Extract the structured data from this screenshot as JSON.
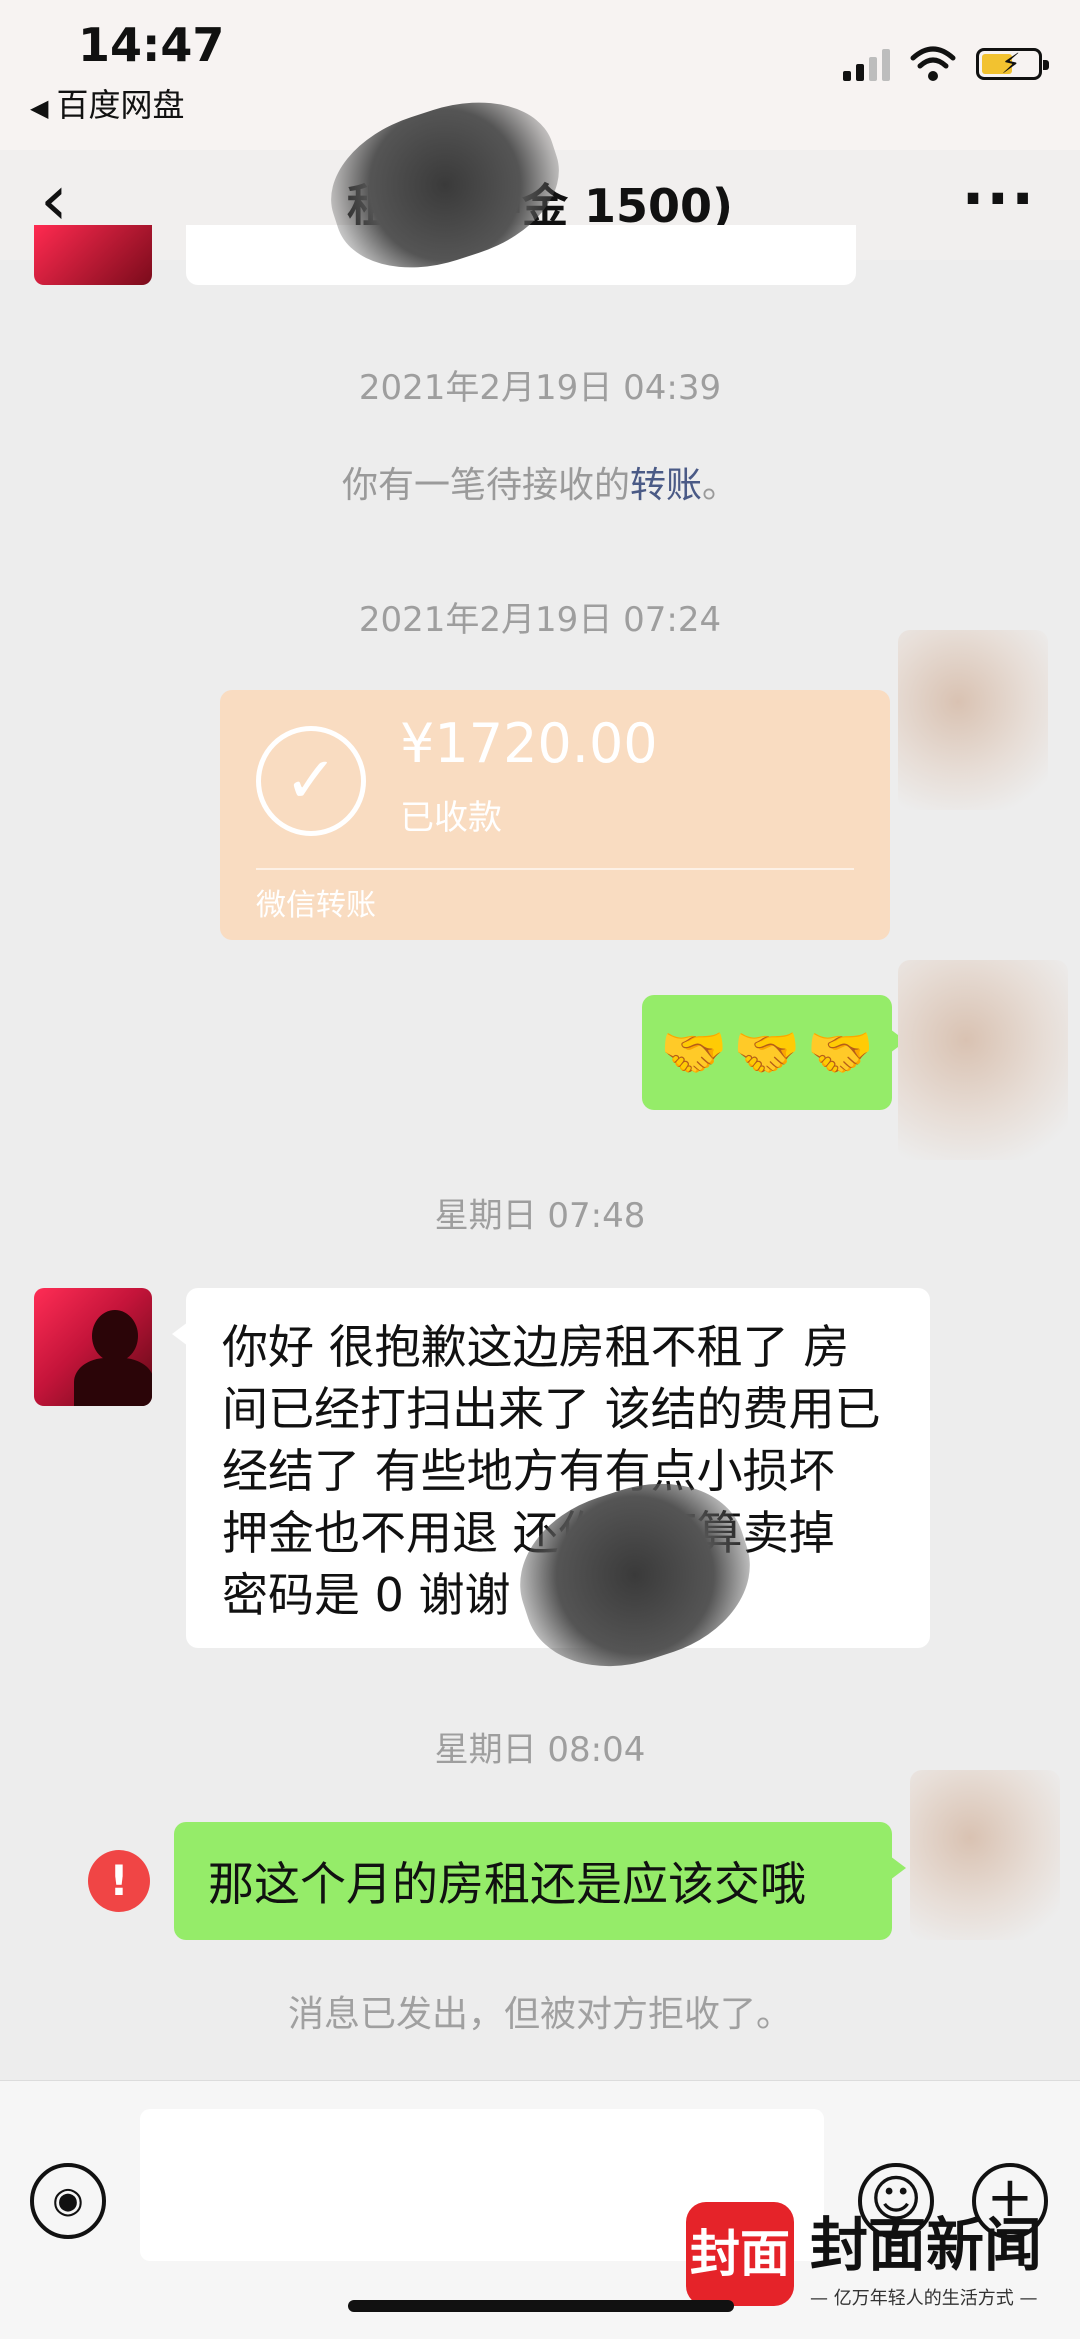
{
  "status_bar": {
    "time": "14:47",
    "back_app": "百度网盘",
    "back_arrow": "◀",
    "battery_bolt": "⚡"
  },
  "nav": {
    "back_icon": "‹",
    "title": "租客 (押金 1500)",
    "more_icon": "···"
  },
  "messages": {
    "time1": "2021年2月19日 04:39",
    "pending_prefix": "你有一笔待接收的",
    "pending_link": "转账",
    "pending_suffix": "。",
    "time2": "2021年2月19日 07:24",
    "transfer": {
      "check_icon": "✓",
      "amount": "¥1720.00",
      "state": "已收款",
      "type": "微信转账"
    },
    "emoji_message": [
      "🤝",
      "🤝",
      "🤝"
    ],
    "time3": "星期日 07:48",
    "incoming_text": "你好 很抱歉这边房租不租了 房间已经打扫出来了 该结的费用已经结了 有些地方有有点小损坏 押金也不用退 还你们打算卖掉 密码是 0 谢谢",
    "time4": "星期日 08:04",
    "alert_icon": "!",
    "outgoing_text": "那这个月的房租还是应该交哦",
    "reject_note": "消息已发出，但被对方拒收了。"
  },
  "input_bar": {
    "voice_icon": "◉",
    "emoji_icon": "☺",
    "plus_icon": "+"
  },
  "watermark": {
    "logo": "封面",
    "name": "封面新闻",
    "slogan": "— 亿万年轻人的生活方式 —"
  },
  "colors": {
    "background": "#ededed",
    "green_bubble": "#95ec69",
    "transfer_card": "#f9dcc1",
    "alert": "#f04545",
    "link": "#4a5a86",
    "watermark_red": "#e52329"
  }
}
